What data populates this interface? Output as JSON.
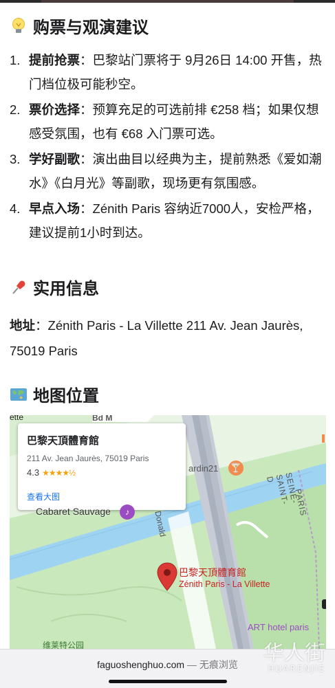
{
  "section_tips": {
    "icon": "lightbulb-icon",
    "title": "购票与观演建议"
  },
  "tips": [
    {
      "num": "1.",
      "label": "提前抢票",
      "text": "：巴黎站门票将于 9月26日 14:00 开售，热门档位极可能秒空。"
    },
    {
      "num": "2.",
      "label": "票价选择",
      "text": "：预算充足的可选前排 €258 档；如果仅想感受氛围，也有 €68 入门票可选。"
    },
    {
      "num": "3.",
      "label": "学好副歌",
      "text": "：演出曲目以经典为主，提前熟悉《爱如潮水》《白月光》等副歌，现场更有氛围感。"
    },
    {
      "num": "4.",
      "label": "早点入场",
      "text": "：Zénith Paris 容纳近7000人，安检严格，建议提前1小时到达。"
    }
  ],
  "section_info": {
    "icon": "pushpin-icon",
    "title": "实用信息"
  },
  "address": {
    "label": "地址",
    "text": "：Zénith Paris - La Villette 211 Av. Jean Jaurès, 75019 Paris"
  },
  "section_map": {
    "icon": "world-map-icon",
    "title": "地图位置"
  },
  "map": {
    "card": {
      "name": "巴黎天頂體育館",
      "street": "211 Av. Jean Jaurès, 75019 Paris",
      "rating": "4.3",
      "stars_glyph": "★★★★½",
      "view_larger": "查看大图"
    },
    "labels": {
      "top_left": "ette",
      "bd": "Bd M",
      "jardin": "ardin21",
      "cabaret": "Cabaret Sauvage",
      "donald": "Donald",
      "seine_1": "SEINE-SAINT-D",
      "seine_2": "PARIS",
      "venue_cn": "巴黎天頂體育館",
      "venue_fr": "Zénith Paris - La Villette",
      "art_hotel": "ART hotel paris",
      "park": "维莱特公园"
    },
    "colors": {
      "water": "#9fd3f2",
      "park": "#c6e8b9",
      "pin": "#db3a34",
      "poi": "#f28b4b",
      "purple": "#9b4cc2"
    }
  },
  "footer": {
    "site": "faguoshenghuo.com",
    "suffix": " — 无痕浏览"
  },
  "watermark": {
    "main": "华人街",
    "sub": "HUARENJIE"
  }
}
